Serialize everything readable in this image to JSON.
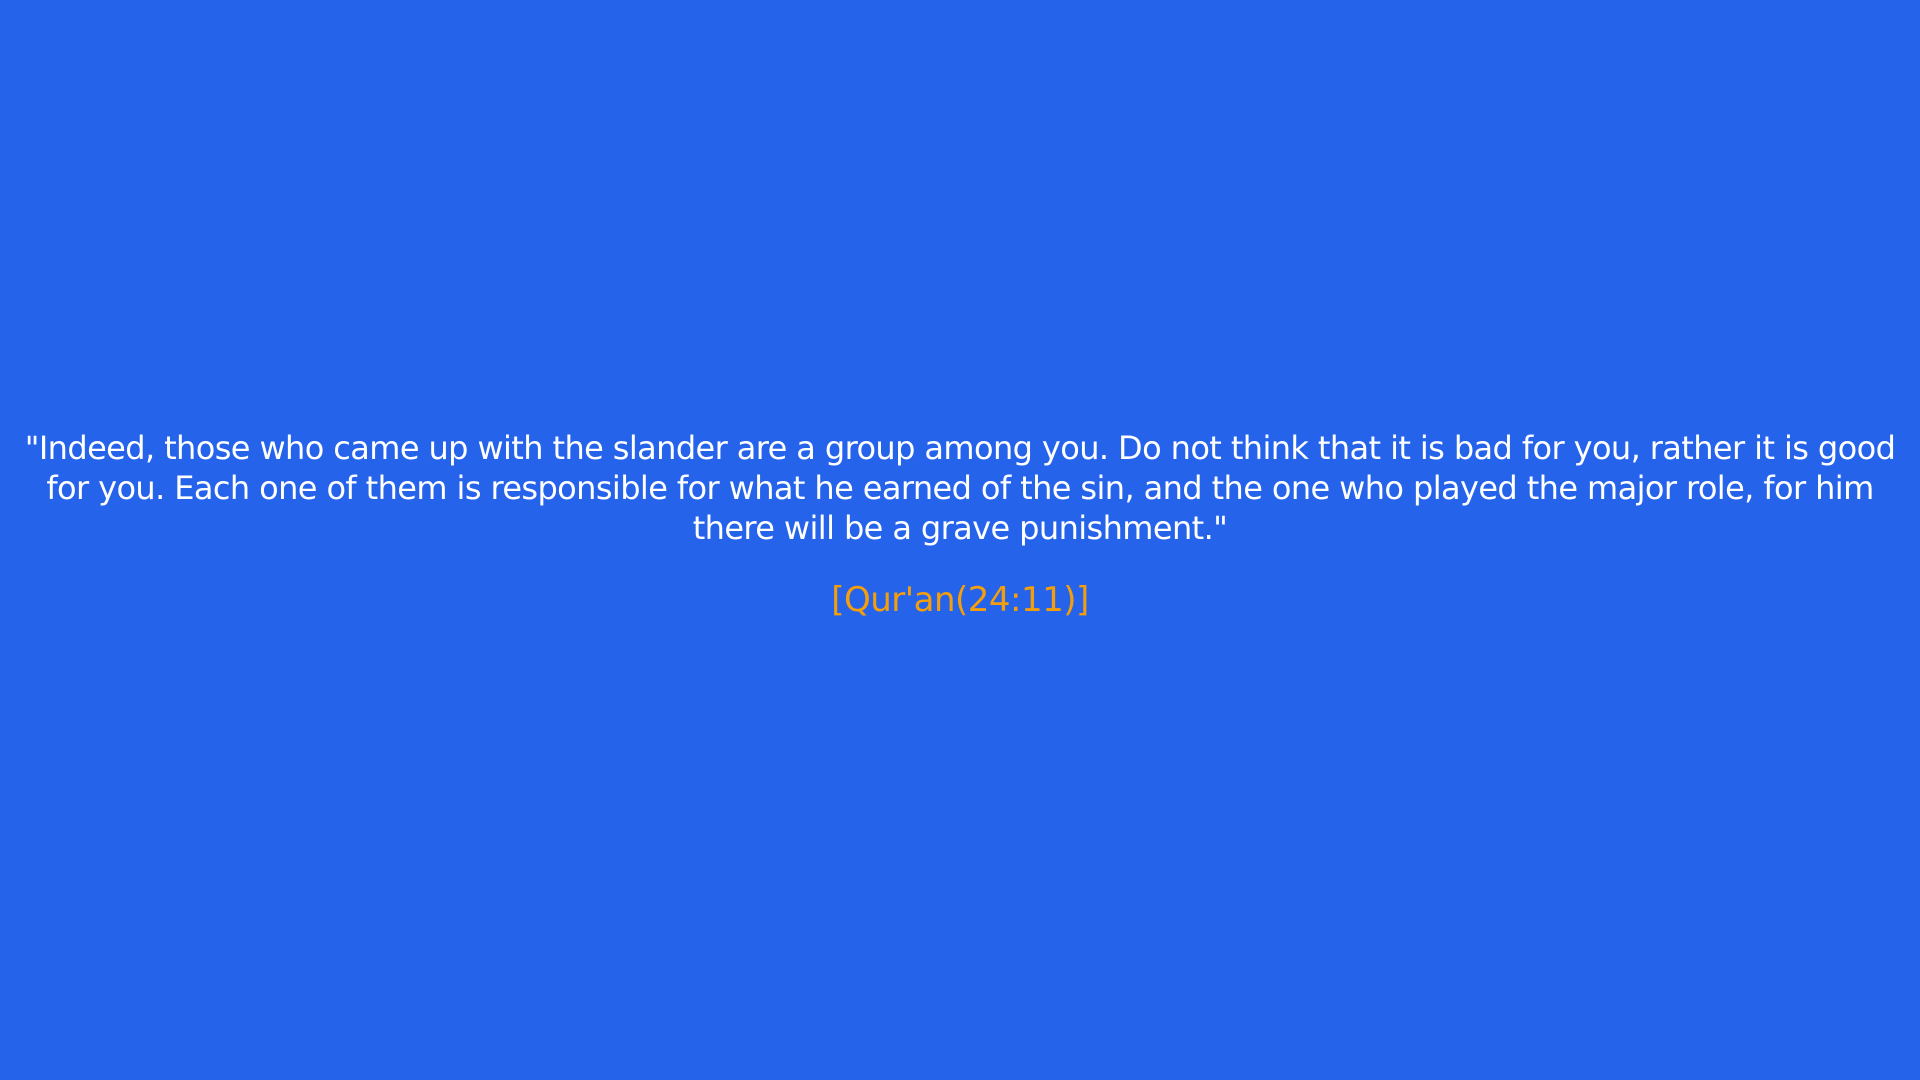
{
  "colors": {
    "background": "#2563eb",
    "quote_text": "#ffffff",
    "citation_text": "#f59e0b"
  },
  "quote": {
    "text": "\"Indeed, those who came up with the slander are a group among you. Do not think that it is bad for you, rather it is good for you. Each one of them is responsible for what he earned of the sin, and the one who played the major role, for him there will be a grave punishment.\"",
    "citation": "[Qur'an(24:11)]"
  }
}
